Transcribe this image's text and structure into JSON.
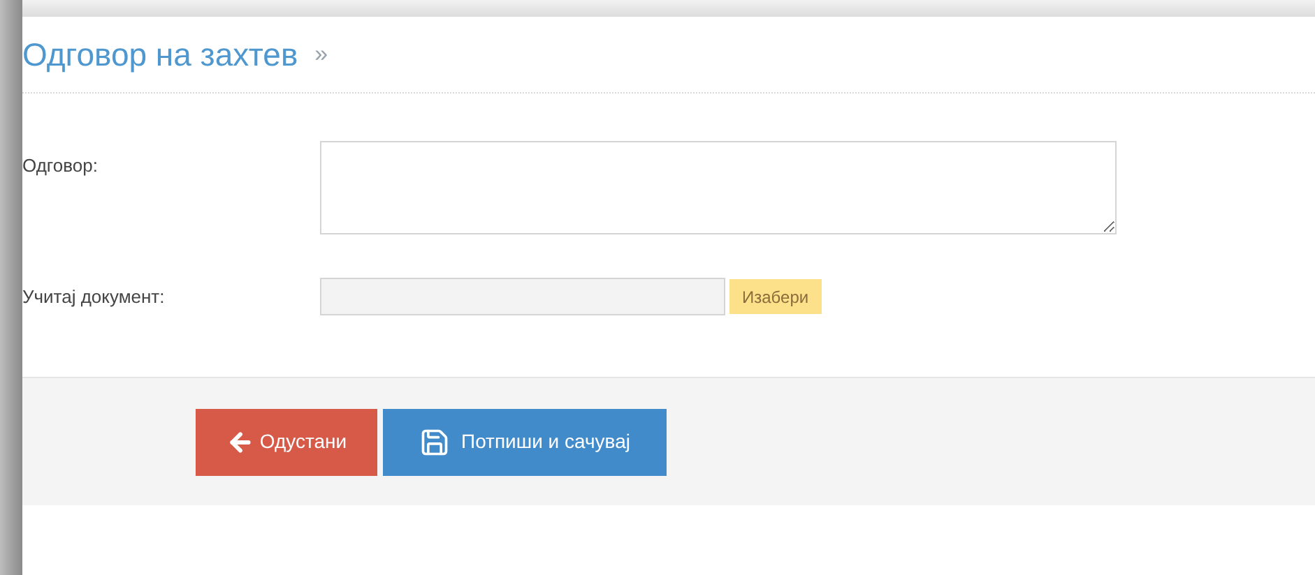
{
  "header": {
    "title": "Одговор на захтев",
    "breadcrumb_mark": "»"
  },
  "form": {
    "fields": [
      {
        "kind": "textarea",
        "label": "Одговор:"
      },
      {
        "kind": "file",
        "label": "Учитај документ:",
        "button": "Изабери"
      }
    ]
  },
  "actions": [
    {
      "kind": "cancel",
      "label": "Одустани"
    },
    {
      "kind": "save",
      "label": "Потпиши и сачувај"
    }
  ]
}
